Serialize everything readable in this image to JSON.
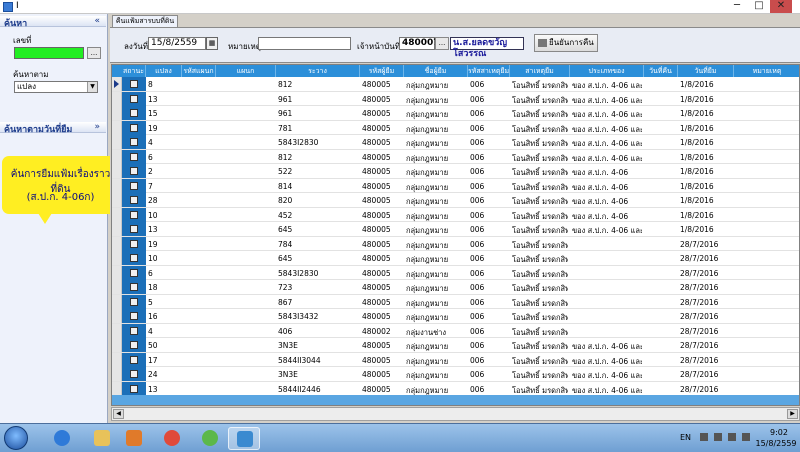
{
  "window": {
    "title": "I",
    "minimize": "─",
    "maximize": "□",
    "close": "✕"
  },
  "left_panel": {
    "search_header": "ค้นหา",
    "search_collapse": "«",
    "serial_label": "เลขที่",
    "search_by_label": "ค้นหาตาม",
    "search_by_value": "แปลง",
    "browse_btn": "...",
    "date_search_header": "ค้นหาตามวันที่ยืม",
    "date_search_collapse": "»",
    "callout_line1": "ค้นการยืมแฟ้มเรื่องราวที่ดิน",
    "callout_line2": "(ส.ป.ก. 4-06ก)"
  },
  "tab": {
    "label": "คืนแฟ้มสารบบที่ดิน"
  },
  "filters": {
    "date_label": "ลงวันที่",
    "date_value": "15/8/2559",
    "note_label": "หมายเหตุ",
    "note_value": "",
    "officer_label": "เจ้าหน้าบันทึก",
    "officer_id": "480007",
    "officer_name": "น.ส.ยลดขวัญ โสวรรณ",
    "confirm_label": "ยืนยันการคืน"
  },
  "grid": {
    "columns": [
      "สถานะ",
      "แปลง",
      "รหัสแผนก",
      "แผนก",
      "ระวาง",
      "รหัสผู้ยืม",
      "ชื่อผู้ยืม",
      "รหัสสาเหตุยืม",
      "สาเหตุยืม",
      "ประเภทของ",
      "วันที่คืน",
      "วันที่ยืม",
      "หมายเหตุ"
    ],
    "rows": [
      [
        "8",
        "",
        "",
        "812",
        "480005",
        "กลุ่มกฎหมาย",
        "006",
        "โอนสิทธิ์ มรดกสิทธิ์",
        "ของ ส.ป.ก. 4-06 และ ร",
        "",
        "1/8/2016",
        ""
      ],
      [
        "13",
        "",
        "",
        "961",
        "480005",
        "กลุ่มกฎหมาย",
        "006",
        "โอนสิทธิ์ มรดกสิทธิ์",
        "ของ ส.ป.ก. 4-06 และ ร",
        "",
        "1/8/2016",
        ""
      ],
      [
        "15",
        "",
        "",
        "961",
        "480005",
        "กลุ่มกฎหมาย",
        "006",
        "โอนสิทธิ์ มรดกสิทธิ์",
        "ของ ส.ป.ก. 4-06 และ ร",
        "",
        "1/8/2016",
        ""
      ],
      [
        "19",
        "",
        "",
        "781",
        "480005",
        "กลุ่มกฎหมาย",
        "006",
        "โอนสิทธิ์ มรดกสิทธิ์",
        "ของ ส.ป.ก. 4-06 และ ร",
        "",
        "1/8/2016",
        ""
      ],
      [
        "4",
        "",
        "",
        "5843I2830",
        "480005",
        "กลุ่มกฎหมาย",
        "006",
        "โอนสิทธิ์ มรดกสิทธิ์",
        "ของ ส.ป.ก. 4-06 และ ร",
        "",
        "1/8/2016",
        ""
      ],
      [
        "6",
        "",
        "",
        "812",
        "480005",
        "กลุ่มกฎหมาย",
        "006",
        "โอนสิทธิ์ มรดกสิทธิ์",
        "ของ ส.ป.ก. 4-06 และ ร",
        "",
        "1/8/2016",
        ""
      ],
      [
        "2",
        "",
        "",
        "522",
        "480005",
        "กลุ่มกฎหมาย",
        "006",
        "โอนสิทธิ์ มรดกสิทธิ์",
        "ของ ส.ป.ก. 4-06",
        "",
        "1/8/2016",
        ""
      ],
      [
        "7",
        "",
        "",
        "814",
        "480005",
        "กลุ่มกฎหมาย",
        "006",
        "โอนสิทธิ์ มรดกสิทธิ์",
        "ของ ส.ป.ก. 4-06",
        "",
        "1/8/2016",
        ""
      ],
      [
        "28",
        "",
        "",
        "820",
        "480005",
        "กลุ่มกฎหมาย",
        "006",
        "โอนสิทธิ์ มรดกสิทธิ์",
        "ของ ส.ป.ก. 4-06",
        "",
        "1/8/2016",
        ""
      ],
      [
        "10",
        "",
        "",
        "452",
        "480005",
        "กลุ่มกฎหมาย",
        "006",
        "โอนสิทธิ์ มรดกสิทธิ์",
        "ของ ส.ป.ก. 4-06",
        "",
        "1/8/2016",
        ""
      ],
      [
        "13",
        "",
        "",
        "645",
        "480005",
        "กลุ่มกฎหมาย",
        "006",
        "โอนสิทธิ์ มรดกสิทธิ์",
        "ของ ส.ป.ก. 4-06 และ ร",
        "",
        "1/8/2016",
        ""
      ],
      [
        "19",
        "",
        "",
        "784",
        "480005",
        "กลุ่มกฎหมาย",
        "006",
        "โอนสิทธิ์ มรดกสิทธิ์",
        "",
        "",
        "28/7/2016",
        ""
      ],
      [
        "10",
        "",
        "",
        "645",
        "480005",
        "กลุ่มกฎหมาย",
        "006",
        "โอนสิทธิ์ มรดกสิทธิ์",
        "",
        "",
        "28/7/2016",
        ""
      ],
      [
        "6",
        "",
        "",
        "5843I2830",
        "480005",
        "กลุ่มกฎหมาย",
        "006",
        "โอนสิทธิ์ มรดกสิทธิ์",
        "",
        "",
        "28/7/2016",
        ""
      ],
      [
        "18",
        "",
        "",
        "723",
        "480005",
        "กลุ่มกฎหมาย",
        "006",
        "โอนสิทธิ์ มรดกสิทธิ์",
        "",
        "",
        "28/7/2016",
        ""
      ],
      [
        "5",
        "",
        "",
        "867",
        "480005",
        "กลุ่มกฎหมาย",
        "006",
        "โอนสิทธิ์ มรดกสิทธิ์",
        "",
        "",
        "28/7/2016",
        ""
      ],
      [
        "16",
        "",
        "",
        "5843I3432",
        "480005",
        "กลุ่มกฎหมาย",
        "006",
        "โอนสิทธิ์ มรดกสิทธิ์",
        "",
        "",
        "28/7/2016",
        ""
      ],
      [
        "4",
        "",
        "",
        "406",
        "480002",
        "กลุ่มงานช่าง",
        "006",
        "โอนสิทธิ์ มรดกสิทธิ์",
        "",
        "",
        "28/7/2016",
        ""
      ],
      [
        "50",
        "",
        "",
        "3N3E",
        "480005",
        "กลุ่มกฎหมาย",
        "006",
        "โอนสิทธิ์ มรดกสิทธิ์",
        "ของ ส.ป.ก. 4-06 และ ร",
        "",
        "28/7/2016",
        ""
      ],
      [
        "17",
        "",
        "",
        "5844II3044",
        "480005",
        "กลุ่มกฎหมาย",
        "006",
        "โอนสิทธิ์ มรดกสิทธิ์",
        "ของ ส.ป.ก. 4-06 และ ร",
        "",
        "28/7/2016",
        ""
      ],
      [
        "24",
        "",
        "",
        "3N3E",
        "480005",
        "กลุ่มกฎหมาย",
        "006",
        "โอนสิทธิ์ มรดกสิทธิ์",
        "ของ ส.ป.ก. 4-06 และ ร",
        "",
        "28/7/2016",
        ""
      ],
      [
        "13",
        "",
        "",
        "5844II2446",
        "480005",
        "กลุ่มกฎหมาย",
        "006",
        "โอนสิทธิ์ มรดกสิทธิ์",
        "ของ ส.ป.ก. 4-06 และ ร",
        "",
        "28/7/2016",
        ""
      ]
    ]
  },
  "taskbar": {
    "language": "EN",
    "time": "9:02",
    "date": "15/8/2559",
    "apps": [
      "windows-start",
      "internet-explorer",
      "file-explorer",
      "media-player",
      "chrome",
      "utorrent",
      "app-window"
    ]
  },
  "colors": {
    "grid_header": "#2c8fd9",
    "status_cell": "#1b6fb8",
    "serial_field": "#22ee22",
    "callout": "#ffee22"
  }
}
